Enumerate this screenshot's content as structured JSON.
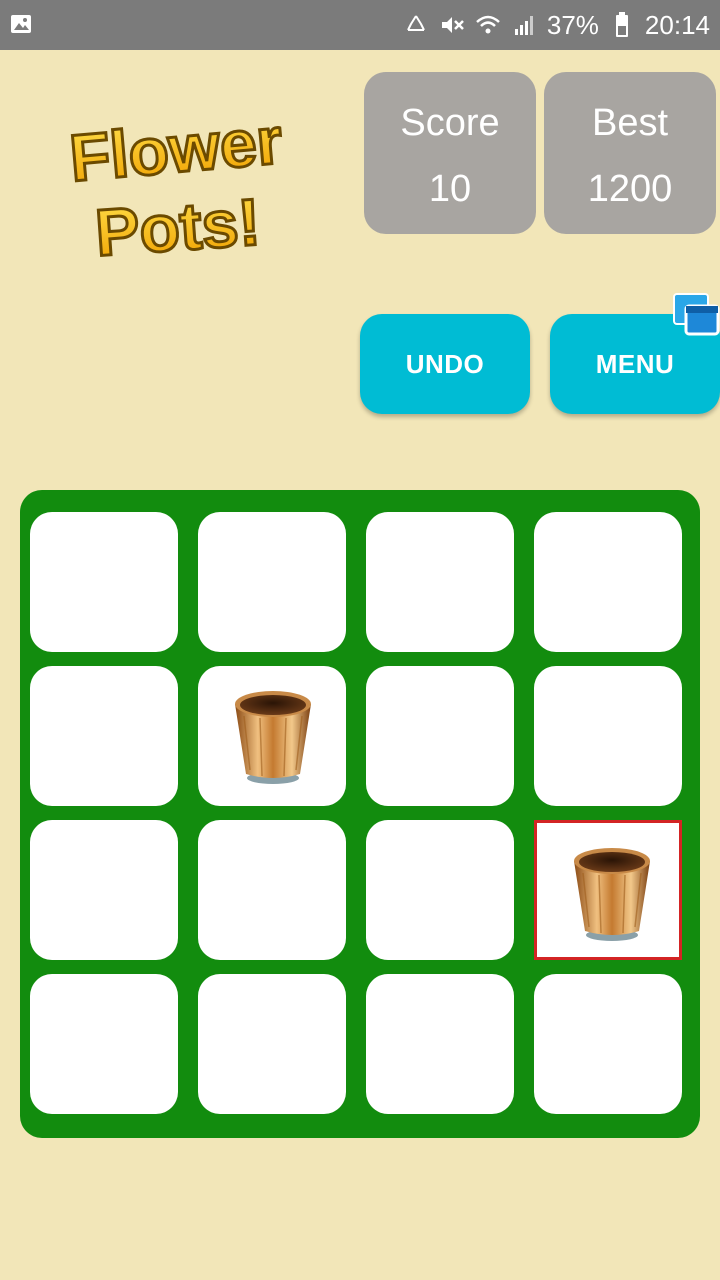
{
  "status_bar": {
    "battery": "37%",
    "time": "20:14",
    "icons": [
      "image-icon",
      "recycle-icon",
      "mute-icon",
      "wifi-icon",
      "signal-icon",
      "battery-icon"
    ]
  },
  "logo": {
    "line1": "Flower",
    "line2": "Pots!"
  },
  "scores": {
    "score_label": "Score",
    "score_value": "10",
    "best_label": "Best",
    "best_value": "1200"
  },
  "buttons": {
    "undo": "UNDO",
    "menu": "MENU"
  },
  "colors": {
    "background": "#f2e6b8",
    "board": "#128c0e",
    "button": "#00bcd4",
    "score_box": "#a8a5a1",
    "selected_border": "#d32424"
  },
  "board": {
    "rows": 4,
    "cols": 4,
    "tiles": [
      [
        "",
        "",
        "",
        ""
      ],
      [
        "",
        "pot",
        "",
        ""
      ],
      [
        "",
        "",
        "",
        "pot"
      ],
      [
        "",
        "",
        "",
        ""
      ]
    ],
    "selected": [
      2,
      3
    ]
  }
}
